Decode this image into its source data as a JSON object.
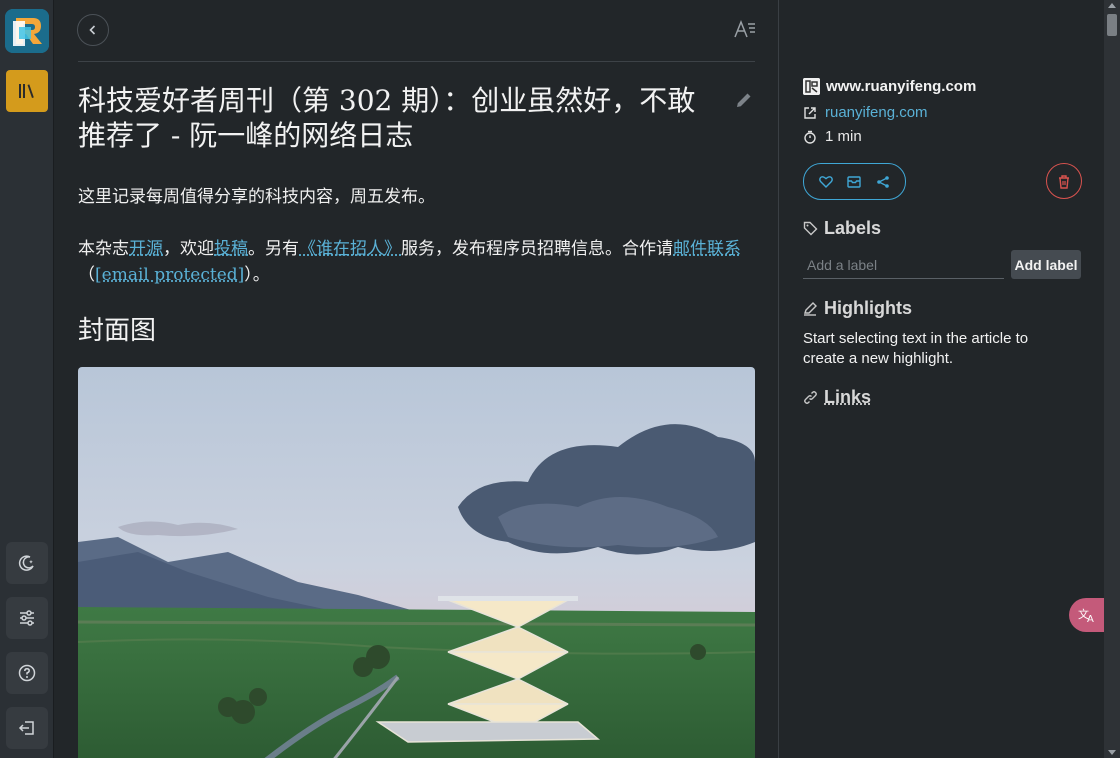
{
  "nav": {
    "back_icon": "chevron-left-icon",
    "font_icon": "text-format-icon",
    "rail_icons": [
      "library-icon",
      "moon-icon",
      "sliders-icon",
      "help-icon",
      "logout-icon"
    ]
  },
  "article": {
    "title": "科技爱好者周刊（第 302 期）：创业虽然好，不敢推荐了 - 阮一峰的网络日志",
    "intro": "这里记录每周值得分享的科技内容，周五发布。",
    "p2": {
      "t1": "本杂志",
      "l1": "开源",
      "t2": "，欢迎",
      "l2": "投稿",
      "t3": "。另有",
      "l3": "《谁在招人》",
      "t4": "服务，发布程序员招聘信息。合作请",
      "l4": "邮件联系",
      "t5": "（",
      "l5": "[email protected]",
      "t6": "）。"
    },
    "section_heading": "封面图"
  },
  "panel": {
    "site_name": "www.ruanyifeng.com",
    "site_link": "ruanyifeng.com",
    "read_time": "1 min",
    "labels_title": "Labels",
    "label_placeholder": "Add a label",
    "add_label": "Add label",
    "highlights_title": "Highlights",
    "highlights_text": "Start selecting text in the article to create a new highlight.",
    "links_title": "Links"
  },
  "colors": {
    "accent": "#5ab1d6",
    "library": "#d49b1c",
    "danger": "#d9534f"
  }
}
